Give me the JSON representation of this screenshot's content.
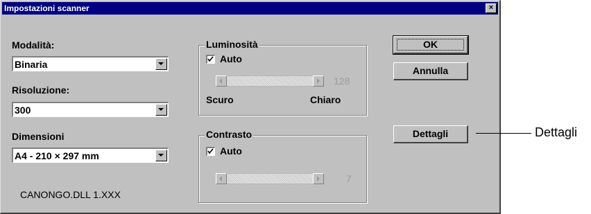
{
  "window": {
    "title": "Impostazioni scanner",
    "close_glyph": "×"
  },
  "left": {
    "mode_label": "Modalità:",
    "mode_value": "Binaria",
    "resolution_label": "Risoluzione:",
    "resolution_value": "300",
    "size_label": "Dimensioni",
    "size_value": "A4 - 210 × 297 mm",
    "footer": "CANONGO.DLL 1.XXX"
  },
  "brightness": {
    "title": "Luminosità",
    "auto_label": "Auto",
    "auto_checked": true,
    "value": "128",
    "min_label": "Scuro",
    "max_label": "Chiaro"
  },
  "contrast": {
    "title": "Contrasto",
    "auto_label": "Auto",
    "auto_checked": true,
    "value": "7"
  },
  "buttons": {
    "ok": "OK",
    "cancel": "Annulla",
    "details": "Dettagli"
  },
  "callout": {
    "text": "Dettagli"
  },
  "colors": {
    "dialog_bg": "#c0c0c0",
    "title_bar": "#000080",
    "disabled_text": "#9a9a9a"
  }
}
